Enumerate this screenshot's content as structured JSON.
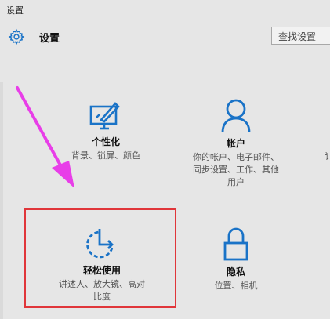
{
  "window": {
    "title": "设置"
  },
  "header": {
    "title": "设置",
    "search_placeholder": "查找设置",
    "gear_icon": "gear-icon"
  },
  "tiles": [
    {
      "label": "个性化",
      "desc": [
        "背景、锁屏、颜色"
      ],
      "icon": "personalization-icon"
    },
    {
      "label": "帐户",
      "desc": [
        "你的帐户、电子邮件、",
        "同步设置、工作、其他",
        "用户"
      ],
      "icon": "account-icon"
    },
    {
      "label": "轻松使用",
      "desc": [
        "讲述人、放大镜、高对",
        "比度"
      ],
      "icon": "ease-of-access-icon"
    },
    {
      "label": "隐私",
      "desc": [
        "位置、相机"
      ],
      "icon": "lock-icon"
    }
  ],
  "cutoff_text": "讠",
  "colors": {
    "accent": "#1a73c7",
    "highlight_box": "#e0363a",
    "arrow": "#e83ee8"
  }
}
